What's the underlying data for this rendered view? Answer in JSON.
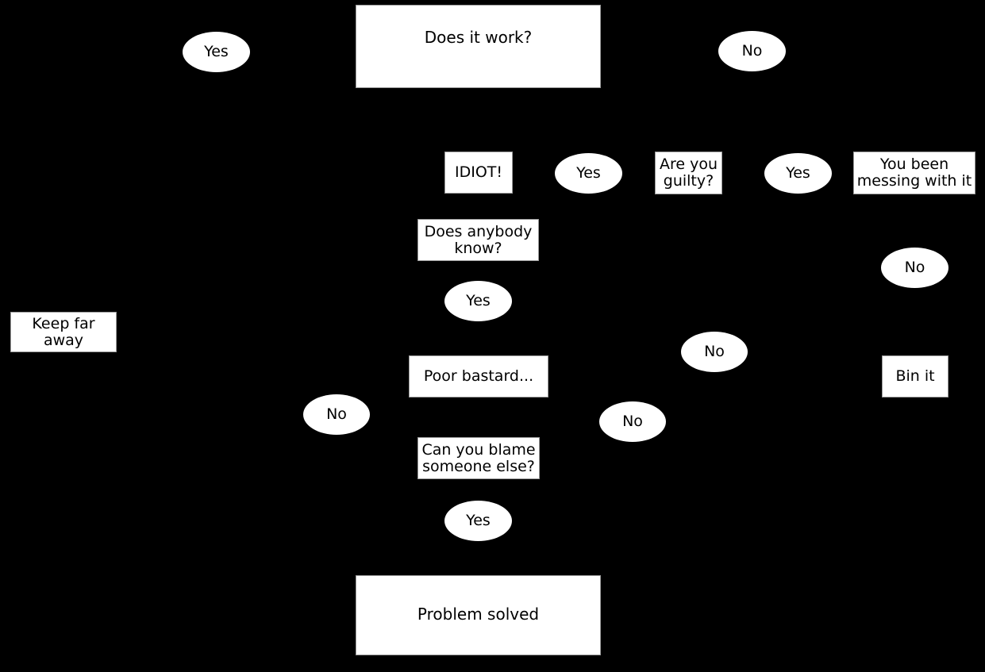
{
  "diagram": {
    "title": "Does it work? troubleshooting flowchart",
    "background_color": "#000000",
    "node_fill_color": "#ffffff",
    "node_text_color": "#000000",
    "node_border_color": "#9b9b9b",
    "nodes": [
      {
        "id": "does_it_work",
        "shape": "box",
        "label": "Does it work?"
      },
      {
        "id": "yes_top_left",
        "shape": "ellipse",
        "label": "Yes"
      },
      {
        "id": "no_top_right",
        "shape": "ellipse",
        "label": "No"
      },
      {
        "id": "idiot",
        "shape": "box",
        "label": "IDIOT!"
      },
      {
        "id": "yes_row2_mid",
        "shape": "ellipse",
        "label": "Yes"
      },
      {
        "id": "are_you_guilty",
        "shape": "box",
        "label_line1": "Are you",
        "label_line2": "guilty?"
      },
      {
        "id": "yes_row2_right",
        "shape": "ellipse",
        "label": "Yes"
      },
      {
        "id": "you_been_messing",
        "shape": "box",
        "label_line1": "You been",
        "label_line2": "messing with it"
      },
      {
        "id": "does_anybody_know",
        "shape": "box",
        "label_line1": "Does anybody",
        "label_line2": "know?"
      },
      {
        "id": "no_right_upper",
        "shape": "ellipse",
        "label": "No"
      },
      {
        "id": "yes_mid_upper",
        "shape": "ellipse",
        "label": "Yes"
      },
      {
        "id": "keep_far_away",
        "shape": "box",
        "label_line1": "Keep far",
        "label_line2": "away"
      },
      {
        "id": "poor_bastard",
        "shape": "box",
        "label": "Poor bastard..."
      },
      {
        "id": "no_mid_right",
        "shape": "ellipse",
        "label": "No"
      },
      {
        "id": "bin_it",
        "shape": "box",
        "label": "Bin it"
      },
      {
        "id": "no_left_lower",
        "shape": "ellipse",
        "label": "No"
      },
      {
        "id": "no_center_lower",
        "shape": "ellipse",
        "label": "No"
      },
      {
        "id": "can_you_blame",
        "shape": "box",
        "label_line1": "Can you blame",
        "label_line2": "someone else?"
      },
      {
        "id": "yes_bottom",
        "shape": "ellipse",
        "label": "Yes"
      },
      {
        "id": "problem_solved",
        "shape": "box",
        "label": "Problem solved"
      }
    ]
  }
}
